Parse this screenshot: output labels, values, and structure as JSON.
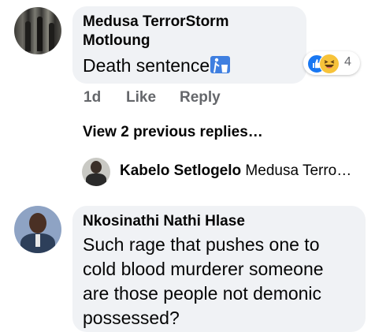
{
  "comments": [
    {
      "author": "Medusa TerrorStorm Motloung",
      "author_line1": "Medusa TerrorStorm",
      "author_line2": "Motloung",
      "text": "Death sentence",
      "emoji": "person-disposing-litter-icon",
      "reactions": {
        "icons": [
          "like-icon",
          "haha-icon"
        ],
        "count": "4"
      },
      "actions": {
        "time": "1d",
        "like": "Like",
        "reply": "Reply"
      }
    },
    {
      "author": "Nkosinathi Nathi Hlase",
      "text_lines": [
        "Such rage that pushes one to",
        "cold blood murderer someone",
        "are those people not demonic",
        "possessed?"
      ]
    }
  ],
  "thread": {
    "view_previous": "View 2 previous replies…",
    "latest_reply": {
      "author": "Kabelo Setlogelo",
      "preview": "Medusa Terro…"
    }
  },
  "colors": {
    "bubble": "#f0f2f5",
    "secondary_text": "#65676b",
    "like_blue": "#1877f2",
    "haha_yellow": "#f7c33a"
  }
}
